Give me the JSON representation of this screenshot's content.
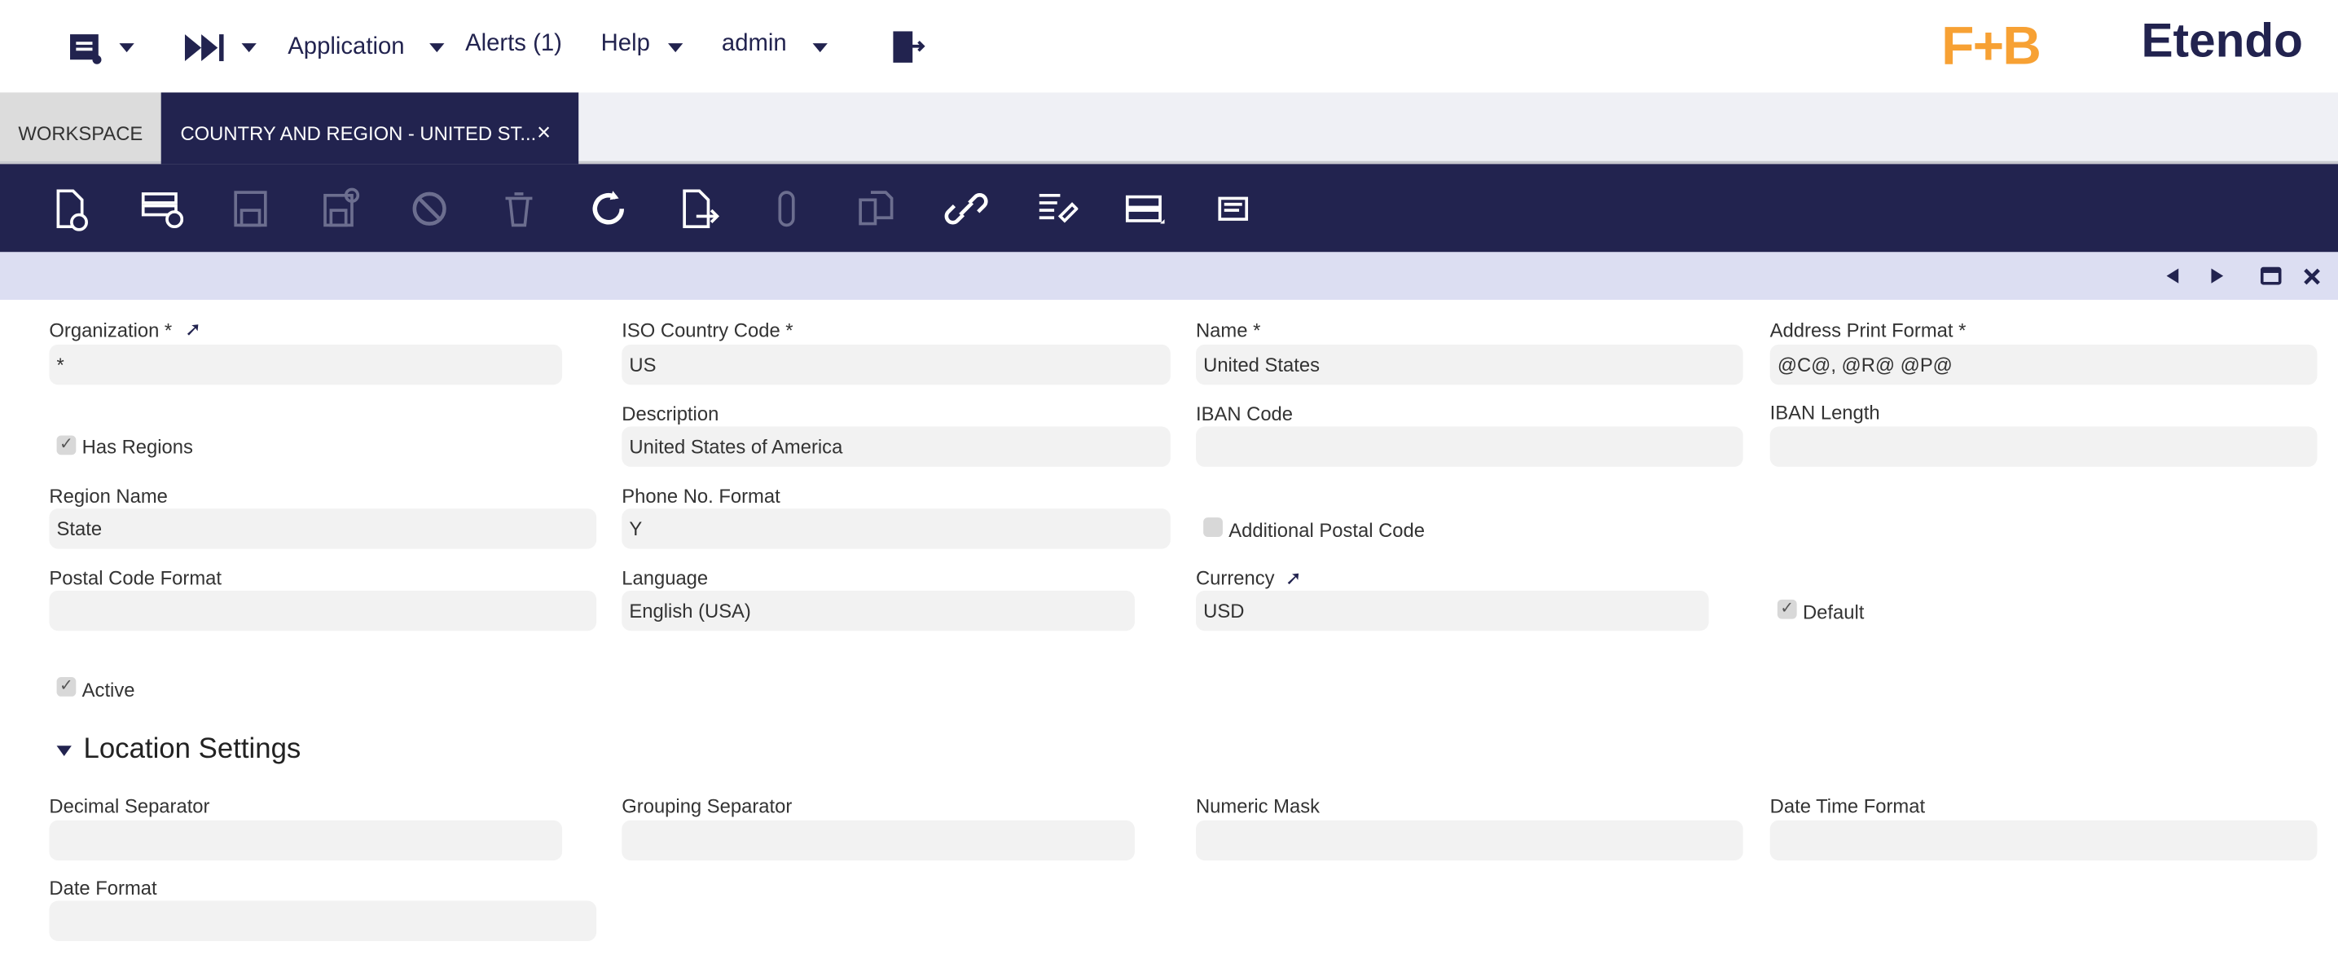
{
  "topnav": {
    "application": "Application",
    "alerts": "Alerts (1)",
    "help": "Help",
    "user": "admin"
  },
  "logos": {
    "brand1": "F+B",
    "brand2": "Etendo"
  },
  "tabs": [
    {
      "label": "WORKSPACE"
    },
    {
      "label": "COUNTRY AND REGION - UNITED ST...",
      "close": "×"
    }
  ],
  "toolbar": [
    "new-document",
    "new-row",
    "save",
    "save-close",
    "undo",
    "delete",
    "refresh",
    "export",
    "attach",
    "clone",
    "link",
    "audit",
    "grid-toggle",
    "notes"
  ],
  "form": {
    "organization": {
      "label": "Organization *",
      "value": "*"
    },
    "iso": {
      "label": "ISO Country Code *",
      "value": "US"
    },
    "name": {
      "label": "Name *",
      "value": "United States"
    },
    "address_format": {
      "label": "Address Print Format *",
      "value": "@C@, @R@ @P@"
    },
    "has_regions": {
      "label": "Has Regions",
      "checked": true
    },
    "description": {
      "label": "Description",
      "value": "United States of America"
    },
    "iban_code": {
      "label": "IBAN Code",
      "value": ""
    },
    "iban_length": {
      "label": "IBAN Length",
      "value": ""
    },
    "region_name": {
      "label": "Region Name",
      "value": "State"
    },
    "phone_format": {
      "label": "Phone No. Format",
      "value": "Y"
    },
    "additional_postal": {
      "label": "Additional Postal Code",
      "checked": false
    },
    "postal_format": {
      "label": "Postal Code Format",
      "value": ""
    },
    "language": {
      "label": "Language",
      "value": "English (USA)"
    },
    "currency": {
      "label": "Currency",
      "value": "USD"
    },
    "default": {
      "label": "Default",
      "checked": true
    },
    "active": {
      "label": "Active",
      "checked": true
    }
  },
  "location": {
    "title": "Location Settings",
    "decimal_sep": {
      "label": "Decimal Separator",
      "value": ""
    },
    "grouping_sep": {
      "label": "Grouping Separator",
      "value": ""
    },
    "numeric_mask": {
      "label": "Numeric Mask",
      "value": ""
    },
    "datetime_format": {
      "label": "Date Time Format",
      "value": ""
    },
    "date_format": {
      "label": "Date Format",
      "value": ""
    }
  },
  "check_mark": "✓"
}
